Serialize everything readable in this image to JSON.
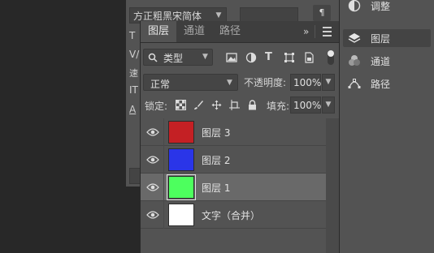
{
  "character": {
    "font_family": "方正粗黑宋简体",
    "side_glyphs": [
      "T",
      "V/",
      "速",
      "IT",
      "A"
    ]
  },
  "layers_panel": {
    "tabs": [
      {
        "label": "图层",
        "active": true
      },
      {
        "label": "通道",
        "active": false
      },
      {
        "label": "路径",
        "active": false
      }
    ],
    "more": "»",
    "filter": {
      "label": "类型"
    },
    "blend_mode": "正常",
    "opacity": {
      "label": "不透明度:",
      "value": "100%"
    },
    "lock_label": "锁定:",
    "fill": {
      "label": "填充:",
      "value": "100%"
    },
    "layers": [
      {
        "name": "图层 3",
        "thumb_color": "#c42024",
        "selected": false
      },
      {
        "name": "图层 2",
        "thumb_color": "#2a35e8",
        "selected": false
      },
      {
        "name": "图层 1",
        "thumb_color": "#4dff5e",
        "selected": true
      },
      {
        "name": "文字（合并）",
        "thumb_color": "#ffffff",
        "selected": false
      }
    ]
  },
  "dock": {
    "items": [
      {
        "label": "调整",
        "icon": "adjustment-icon",
        "active": false
      },
      {
        "label": "图层",
        "icon": "layers-icon",
        "active": true
      },
      {
        "label": "通道",
        "icon": "channels-icon",
        "active": false
      },
      {
        "label": "路径",
        "icon": "paths-icon",
        "active": false
      }
    ]
  }
}
